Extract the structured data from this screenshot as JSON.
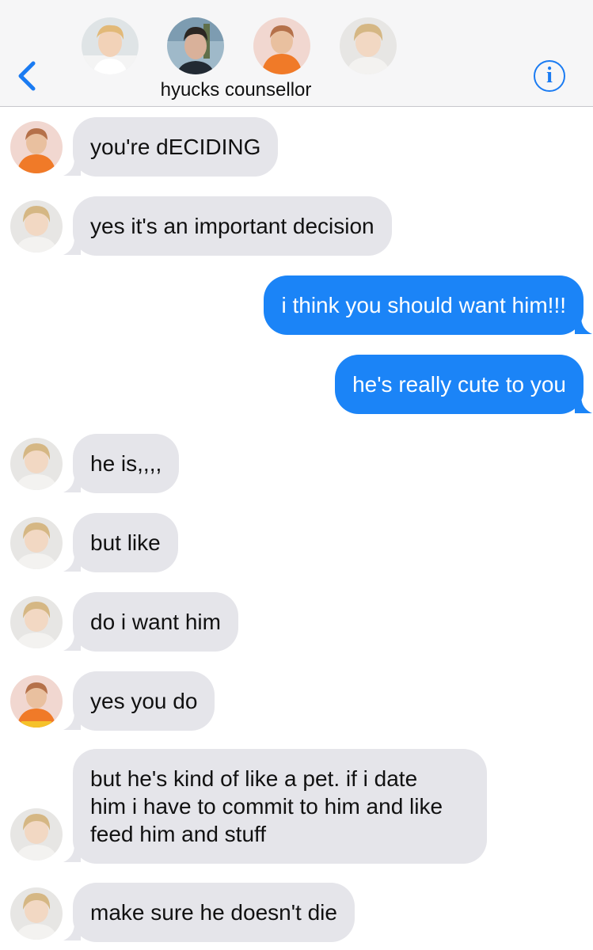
{
  "header": {
    "group_name": "hyucks counsellor",
    "back_icon": "chevron-left-icon",
    "info_icon": "info-icon",
    "info_glyph": "i",
    "accent": "#1a7bf2"
  },
  "messages": [
    {
      "from": "orange-hoodie",
      "text": "you're dECIDING"
    },
    {
      "from": "white-hoodie",
      "text": "yes it's an important decision"
    },
    {
      "from": "me",
      "text": "i think you should want him!!!"
    },
    {
      "from": "me",
      "text": "he's really cute to you"
    },
    {
      "from": "white-hoodie",
      "text": "he is,,,,"
    },
    {
      "from": "white-hoodie",
      "text": "but like"
    },
    {
      "from": "white-hoodie",
      "text": "do i want him"
    },
    {
      "from": "orange-hoodie",
      "text": "yes you do"
    },
    {
      "from": "white-hoodie",
      "lines": [
        "but he's kind of like a pet. if i date",
        "him i have to commit to him and like",
        "feed him and stuff"
      ]
    },
    {
      "from": "white-hoodie",
      "text": "make sure he doesn't die"
    }
  ],
  "colors": {
    "incoming_bubble": "#e5e5ea",
    "outgoing_bubble": "#1b84f7",
    "header_bg": "#f6f6f7"
  }
}
